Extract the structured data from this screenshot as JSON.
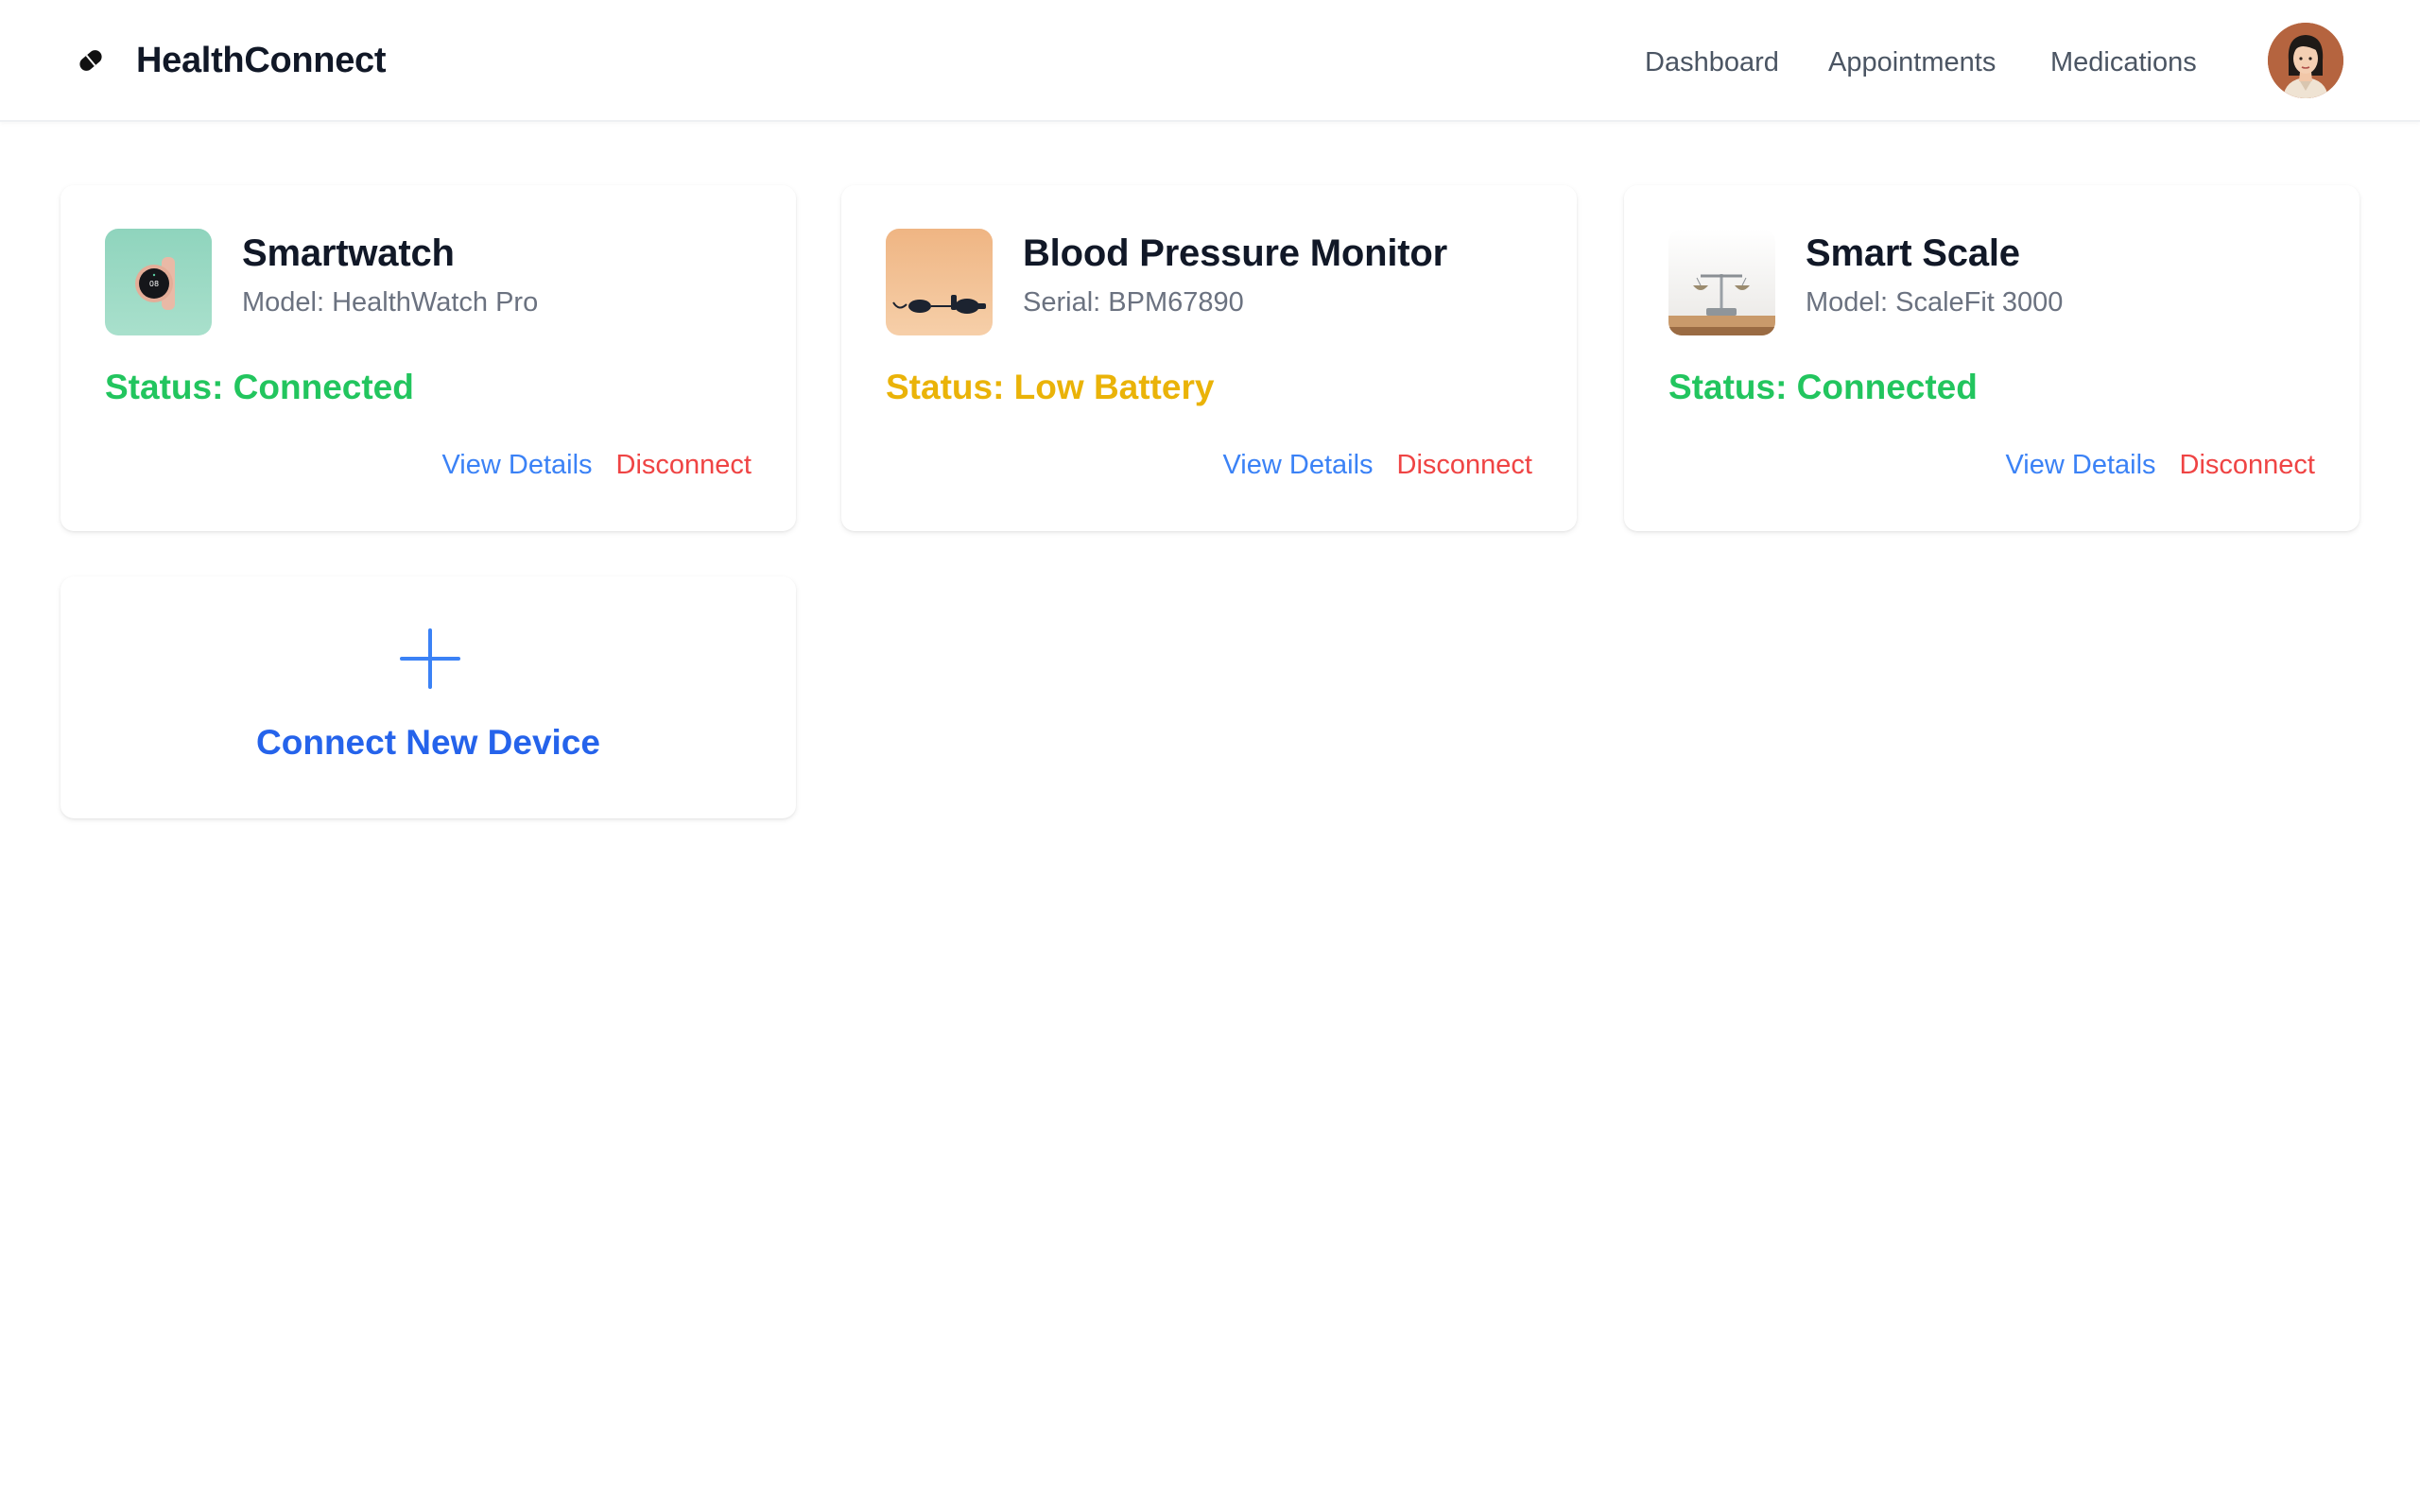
{
  "app": {
    "name": "HealthConnect"
  },
  "nav": {
    "items": [
      {
        "label": "Dashboard"
      },
      {
        "label": "Appointments"
      },
      {
        "label": "Medications"
      }
    ]
  },
  "devices": [
    {
      "name": "Smartwatch",
      "meta": "Model: HealthWatch Pro",
      "status": "Status: Connected",
      "status_color": "#22c55e",
      "view_label": "View Details",
      "disconnect_label": "Disconnect"
    },
    {
      "name": "Blood Pressure Monitor",
      "meta": "Serial: BPM67890",
      "status": "Status: Low Battery",
      "status_color": "#eab308",
      "view_label": "View Details",
      "disconnect_label": "Disconnect"
    },
    {
      "name": "Smart Scale",
      "meta": "Model: ScaleFit 3000",
      "status": "Status: Connected",
      "status_color": "#22c55e",
      "view_label": "View Details",
      "disconnect_label": "Disconnect"
    }
  ],
  "add_device": {
    "label": "Connect New Device"
  },
  "colors": {
    "link": "#3b82f6",
    "danger": "#ef4444",
    "primary": "#2563eb",
    "connected": "#22c55e",
    "warning": "#eab308"
  }
}
